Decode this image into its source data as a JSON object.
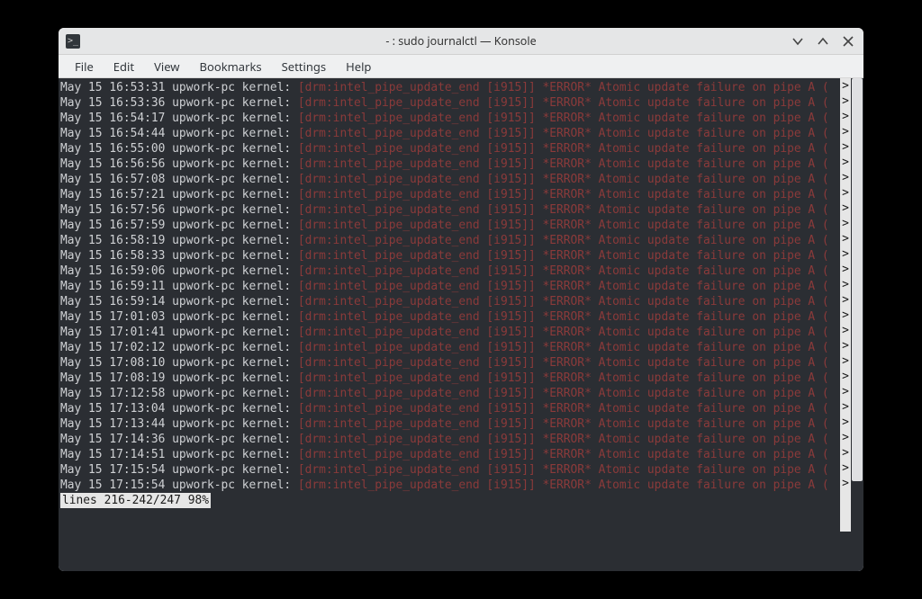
{
  "window": {
    "title": "- : sudo journalctl — Konsole",
    "app_icon_glyph": ">_"
  },
  "menubar": {
    "items": [
      "File",
      "Edit",
      "View",
      "Bookmarks",
      "Settings",
      "Help"
    ]
  },
  "terminal": {
    "host": "upwork-pc",
    "source": "kernel:",
    "date": "May 15",
    "error_msg": "[drm:intel_pipe_update_end [i915]] *ERROR* Atomic update failure on pipe A (",
    "truncation_marker": ">",
    "times": [
      "16:53:31",
      "16:53:36",
      "16:54:17",
      "16:54:44",
      "16:55:00",
      "16:56:56",
      "16:57:08",
      "16:57:21",
      "16:57:56",
      "16:57:59",
      "16:58:19",
      "16:58:33",
      "16:59:06",
      "16:59:11",
      "16:59:14",
      "17:01:03",
      "17:01:41",
      "17:02:12",
      "17:08:10",
      "17:08:19",
      "17:12:58",
      "17:13:04",
      "17:13:44",
      "17:14:36",
      "17:14:51",
      "17:15:54",
      "17:15:54"
    ],
    "pager_status": "lines 216-242/247 98%"
  }
}
